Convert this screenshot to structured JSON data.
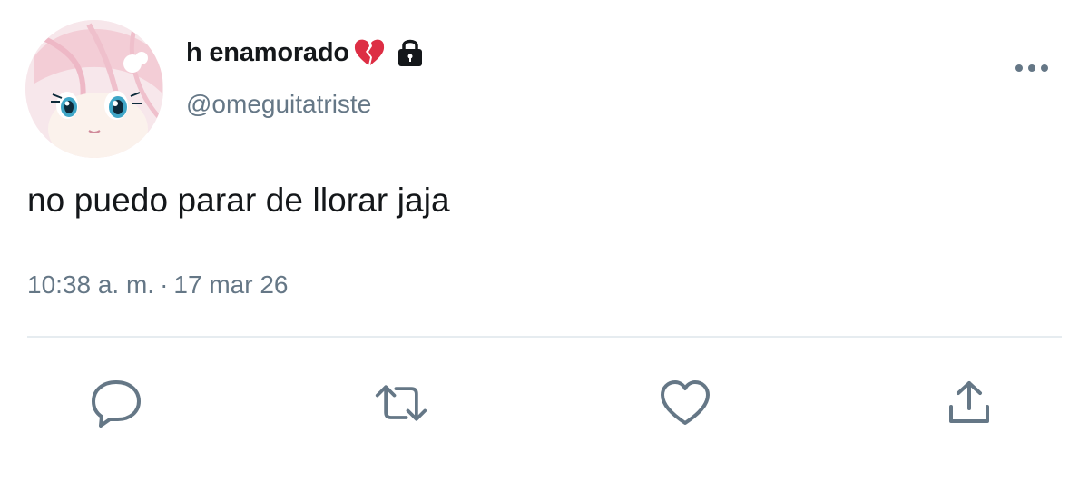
{
  "user": {
    "display_name": "h enamorado",
    "handle": "@omeguitatriste",
    "name_emoji": "broken-heart-icon",
    "protected_icon": "lock-icon",
    "avatar": "avatar"
  },
  "tweet": {
    "text": "no puedo parar de llorar jaja",
    "time": "10:38 a. m.",
    "separator": "·",
    "date": "17 mar 26"
  },
  "actions": [
    {
      "name": "reply",
      "icon": "reply-icon"
    },
    {
      "name": "retweet",
      "icon": "retweet-icon"
    },
    {
      "name": "like",
      "icon": "heart-icon"
    },
    {
      "name": "share",
      "icon": "share-icon"
    }
  ],
  "menu": {
    "icon": "more-icon"
  },
  "colors": {
    "text_primary": "#14171a",
    "text_secondary": "#657786",
    "icon": "#657786",
    "divider": "#e6ecf0",
    "broken_heart": "#dd2e44"
  }
}
